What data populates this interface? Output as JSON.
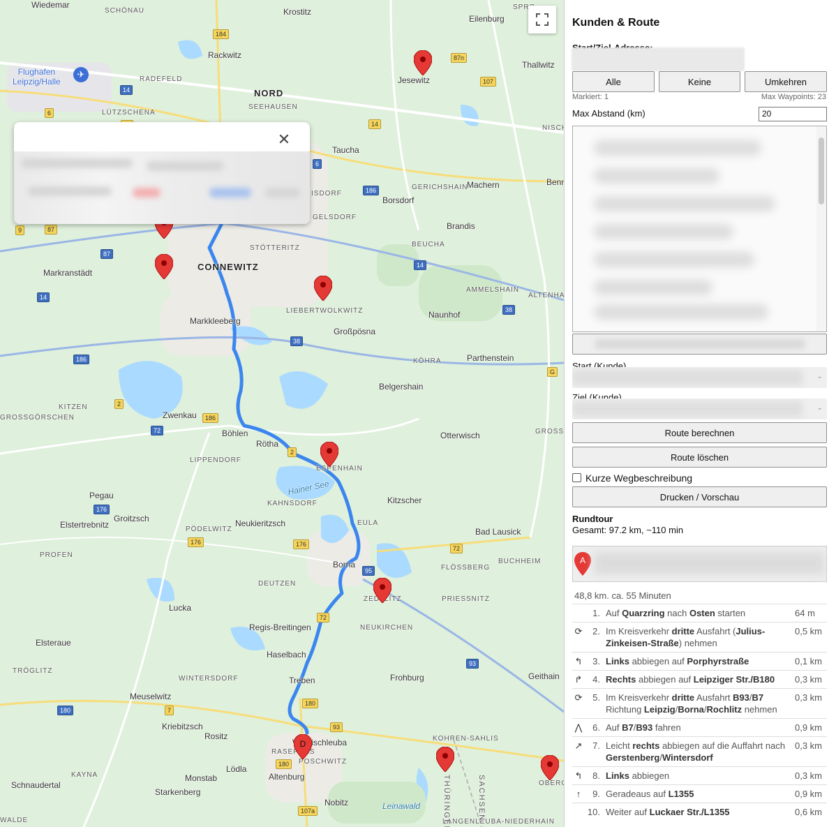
{
  "map": {
    "places": [
      {
        "name": "Wiedemar",
        "cls": ""
      },
      {
        "name": "SCHÖNAU",
        "cls": "small"
      },
      {
        "name": "Krostitz",
        "cls": ""
      },
      {
        "name": "Eilenburg",
        "cls": ""
      },
      {
        "name": "SPRO",
        "cls": "small"
      },
      {
        "name": "Rackwitz",
        "cls": ""
      },
      {
        "name": "Flughafen\nLeipzig/Halle",
        "cls": "airport"
      },
      {
        "name": "RADEFELD",
        "cls": "small"
      },
      {
        "name": "NORD",
        "cls": "big"
      },
      {
        "name": "SEEHAUSEN",
        "cls": "small"
      },
      {
        "name": "Jesewitz",
        "cls": ""
      },
      {
        "name": "Thallwitz",
        "cls": ""
      },
      {
        "name": "LÜTZSCHENA",
        "cls": "small"
      },
      {
        "name": "Taucha",
        "cls": ""
      },
      {
        "name": "NISCH",
        "cls": "small"
      },
      {
        "name": "GERICHSHAIN",
        "cls": "small"
      },
      {
        "name": "Machern",
        "cls": ""
      },
      {
        "name": "Benn",
        "cls": ""
      },
      {
        "name": "Borsdorf",
        "cls": ""
      },
      {
        "name": "ISDORF",
        "cls": "small"
      },
      {
        "name": "GELSDORF",
        "cls": "small"
      },
      {
        "name": "Brandis",
        "cls": ""
      },
      {
        "name": "BEUCHA",
        "cls": "small"
      },
      {
        "name": "STÖTTERITZ",
        "cls": "small"
      },
      {
        "name": "CONNEWITZ",
        "cls": "big"
      },
      {
        "name": "Markranstädt",
        "cls": ""
      },
      {
        "name": "AMMELSHAIN",
        "cls": "small"
      },
      {
        "name": "ALTENHAI",
        "cls": "small"
      },
      {
        "name": "LIEBERTWOLKWITZ",
        "cls": "small"
      },
      {
        "name": "Naunhof",
        "cls": ""
      },
      {
        "name": "Markkleeberg",
        "cls": ""
      },
      {
        "name": "Großpösna",
        "cls": ""
      },
      {
        "name": "Parthenstein",
        "cls": ""
      },
      {
        "name": "KÖHRA",
        "cls": "small"
      },
      {
        "name": "Belgershain",
        "cls": ""
      },
      {
        "name": "KITZEN",
        "cls": "small"
      },
      {
        "name": "GROSSGÖRSCHEN",
        "cls": "small"
      },
      {
        "name": "Zwenkau",
        "cls": ""
      },
      {
        "name": "Böhlen",
        "cls": ""
      },
      {
        "name": "Rötha",
        "cls": ""
      },
      {
        "name": "ESPENHAIN",
        "cls": "small"
      },
      {
        "name": "Otterwisch",
        "cls": ""
      },
      {
        "name": "GROSSB",
        "cls": "small"
      },
      {
        "name": "LIPPENDORF",
        "cls": "small"
      },
      {
        "name": "Pegau",
        "cls": ""
      },
      {
        "name": "KAHNSDORF",
        "cls": "small"
      },
      {
        "name": "Kitzscher",
        "cls": ""
      },
      {
        "name": "Elstertrebnitz",
        "cls": ""
      },
      {
        "name": "Groitzsch",
        "cls": ""
      },
      {
        "name": "PÖDELWITZ",
        "cls": "small"
      },
      {
        "name": "Neukieritzsch",
        "cls": ""
      },
      {
        "name": "EULA",
        "cls": "small"
      },
      {
        "name": "Bad Lausick",
        "cls": ""
      },
      {
        "name": "PROFEN",
        "cls": "small"
      },
      {
        "name": "Borna",
        "cls": ""
      },
      {
        "name": "FLÖSSBERG",
        "cls": "small"
      },
      {
        "name": "BUCHHEIM",
        "cls": "small"
      },
      {
        "name": "DEUTZEN",
        "cls": "small"
      },
      {
        "name": "ZEDTLITZ",
        "cls": "small"
      },
      {
        "name": "PRIESSNITZ",
        "cls": "small"
      },
      {
        "name": "Lucka",
        "cls": ""
      },
      {
        "name": "NEUKIRCHEN",
        "cls": "small"
      },
      {
        "name": "Elsteraue",
        "cls": ""
      },
      {
        "name": "Regis-Breitingen",
        "cls": ""
      },
      {
        "name": "Haselbach",
        "cls": ""
      },
      {
        "name": "Geithain",
        "cls": ""
      },
      {
        "name": "TRÖGLITZ",
        "cls": "small"
      },
      {
        "name": "WINTERSDORF",
        "cls": "small"
      },
      {
        "name": "Treben",
        "cls": ""
      },
      {
        "name": "Frohburg",
        "cls": ""
      },
      {
        "name": "Meuselwitz",
        "cls": ""
      },
      {
        "name": "Kriebitzsch",
        "cls": ""
      },
      {
        "name": "Rositz",
        "cls": ""
      },
      {
        "name": "Windischleuba",
        "cls": ""
      },
      {
        "name": "KOHREN-SAHLIS",
        "cls": "small"
      },
      {
        "name": "RASEPHAS",
        "cls": "small"
      },
      {
        "name": "POSCHWITZ",
        "cls": "small"
      },
      {
        "name": "Lödla",
        "cls": ""
      },
      {
        "name": "Altenburg",
        "cls": ""
      },
      {
        "name": "KAYNA",
        "cls": "small"
      },
      {
        "name": "Monstab",
        "cls": ""
      },
      {
        "name": "Schnaudertal",
        "cls": ""
      },
      {
        "name": "Starkenberg",
        "cls": ""
      },
      {
        "name": "Nobitz",
        "cls": ""
      },
      {
        "name": "WALDE",
        "cls": "small"
      },
      {
        "name": "LANGENLEUBA-NIEDERHAIN",
        "cls": "small"
      },
      {
        "name": "OBERGRÄF",
        "cls": "small"
      }
    ],
    "water_labels": [
      "Hainer See",
      "Leinawald"
    ],
    "state_labels": [
      "THÜRINGEN",
      "SACHSEN"
    ],
    "shields": [
      "184",
      "87n",
      "107",
      "14",
      "6",
      "87",
      "14",
      "6",
      "186",
      "9",
      "87",
      "87",
      "14",
      "14",
      "38",
      "38",
      "186",
      "2",
      "186",
      "72",
      "2",
      "176",
      "176",
      "176",
      "72",
      "95",
      "72",
      "93",
      "180",
      "180",
      "7",
      "93",
      "180",
      "107a",
      "G"
    ],
    "route_marker_label": "D",
    "fullscreen_icon": "fullscreen-icon"
  },
  "popup": {
    "close_label": "✕"
  },
  "sidebar": {
    "title": "Kunden & Route",
    "address_label": "Start/Ziel-Adresse:",
    "buttons": {
      "all": "Alle",
      "none": "Keine",
      "reverse": "Umkehren"
    },
    "marked_count": "Markiert: 1",
    "max_waypoints": "Max Waypoints: 23",
    "max_distance_label": "Max Abstand (km)",
    "max_distance_value": "20",
    "start_label": "Start (Kunde)",
    "end_label": "Ziel (Kunde)",
    "calc_route": "Route berechnen",
    "clear_route": "Route löschen",
    "short_directions": "Kurze Wegbeschreibung",
    "print": "Drucken / Vorschau",
    "round_trip_title": "Rundtour",
    "round_trip_total": "Gesamt: 97.2 km, ~110 min",
    "leg_marker": "A",
    "leg_summary": "48,8 km. ca. 55 Minuten",
    "steps": [
      {
        "n": "1.",
        "icon": "straight-icon",
        "glyph": "",
        "html": "Auf <b>Quarzring</b> nach <b>Osten</b> starten",
        "dist": "64 m"
      },
      {
        "n": "2.",
        "icon": "roundabout-icon",
        "glyph": "⟳",
        "html": "Im Kreisverkehr <b>dritte</b> Ausfahrt (<b>Julius-Zinkeisen-Straße</b>) nehmen",
        "dist": "0,5 km"
      },
      {
        "n": "3.",
        "icon": "turn-left-icon",
        "glyph": "↰",
        "html": "<b>Links</b> abbiegen auf <b>Porphyrstraße</b>",
        "dist": "0,1 km"
      },
      {
        "n": "4.",
        "icon": "turn-right-icon",
        "glyph": "↱",
        "html": "<b>Rechts</b> abbiegen auf <b>Leipziger Str./B180</b>",
        "dist": "0,3 km"
      },
      {
        "n": "5.",
        "icon": "roundabout-icon",
        "glyph": "⟳",
        "html": "Im Kreisverkehr <b>dritte</b> Ausfahrt <b>B93</b>/<b>B7</b> Richtung <b>Leipzig</b>/<b>Borna</b>/<b>Rochlitz</b> nehmen",
        "dist": "0,3 km"
      },
      {
        "n": "6.",
        "icon": "merge-icon",
        "glyph": "⋀",
        "html": "Auf <b>B7</b>/<b>B93</b> fahren",
        "dist": "0,9 km"
      },
      {
        "n": "7.",
        "icon": "slight-right-icon",
        "glyph": "↗",
        "html": "Leicht <b>rechts</b> abbiegen auf die Auffahrt nach <b>Gerstenberg</b>/<b>Wintersdorf</b>",
        "dist": "0,3 km"
      },
      {
        "n": "8.",
        "icon": "turn-left-icon",
        "glyph": "↰",
        "html": "<b>Links</b> abbiegen",
        "dist": "0,3 km"
      },
      {
        "n": "9.",
        "icon": "straight-icon",
        "glyph": "↑",
        "html": "Geradeaus auf <b>L1355</b>",
        "dist": "0,9 km"
      },
      {
        "n": "10.",
        "icon": "straight-icon",
        "glyph": "",
        "html": "Weiter auf <b>Luckaer Str./L1355</b>",
        "dist": "0,6 km"
      }
    ]
  },
  "colors": {
    "map_bg": "#dff0dc",
    "route": "#3b86ee",
    "pin": "#e53935",
    "water": "#aadaff"
  }
}
